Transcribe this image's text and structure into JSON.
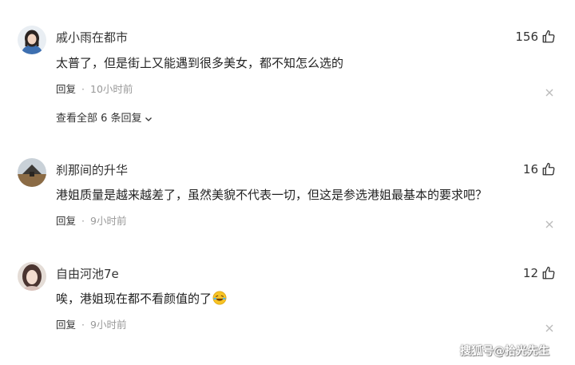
{
  "comments": [
    {
      "username": "戚小雨在都市",
      "likes": "156",
      "text": "太普了，但是街上又能遇到很多美女，都不知怎么选的",
      "reply_label": "回复",
      "separator": "·",
      "time": "10小时前",
      "view_all": "查看全部 6 条回复"
    },
    {
      "username": "刹那间的升华",
      "likes": "16",
      "text": "港姐质量是越来越差了，虽然美貌不代表一切，但这是参选港姐最基本的要求吧？",
      "reply_label": "回复",
      "separator": "·",
      "time": "9小时前"
    },
    {
      "username": "自由河池7e",
      "likes": "12",
      "text": "唉，港姐现在都不看颜值的了",
      "reply_label": "回复",
      "separator": "·",
      "time": "9小时前"
    }
  ],
  "watermark": "搜狐号@拾光先生",
  "icons": {
    "like": "thumbs-up-icon",
    "close": "close-icon",
    "chevron": "chevron-down-icon",
    "emoji": "laughing-crying-emoji"
  }
}
